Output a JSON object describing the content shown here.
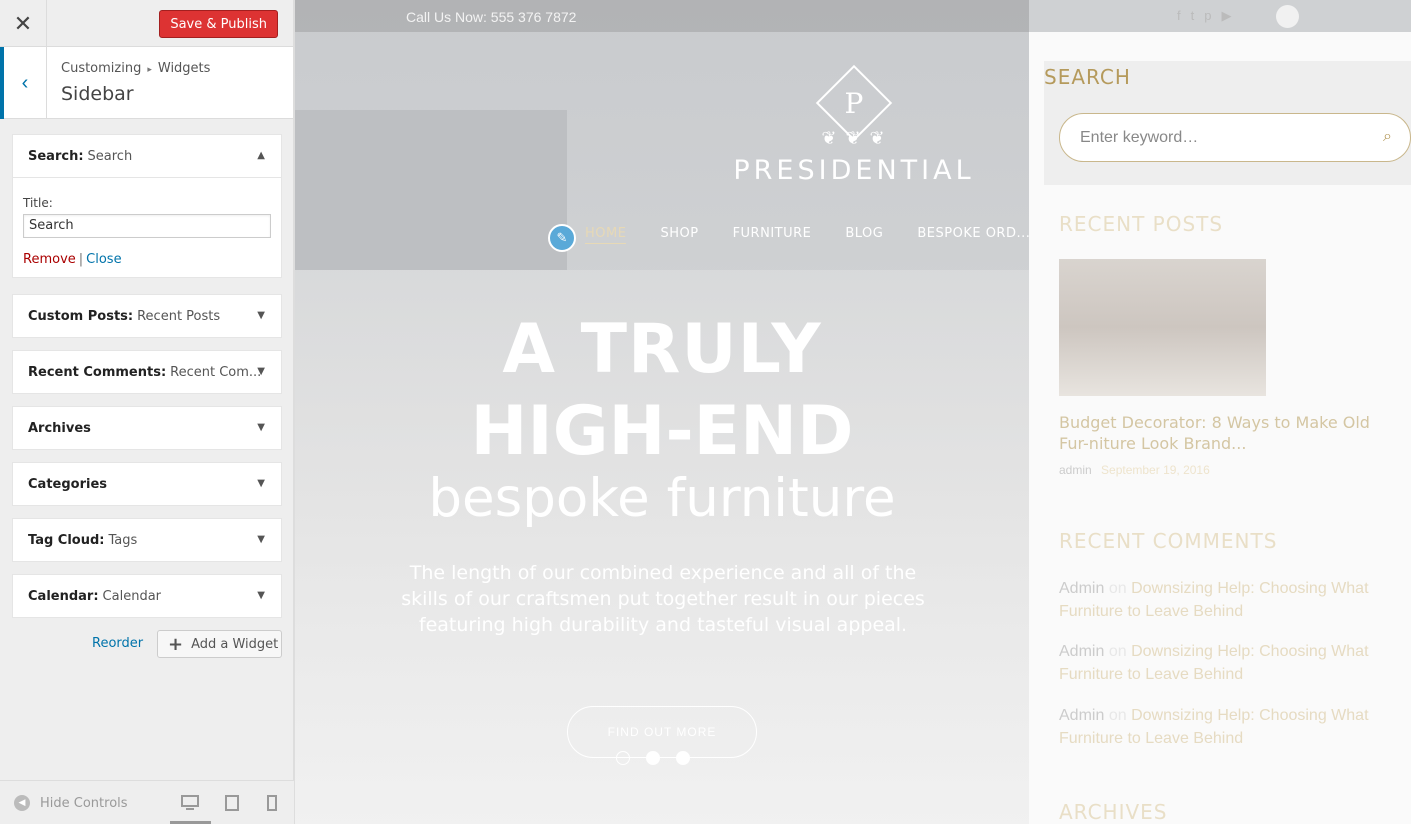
{
  "customizer": {
    "close_icon": "close-icon",
    "publish_label": "Save & Publish",
    "breadcrumb": {
      "root": "Customizing",
      "separator": "▸",
      "current": "Widgets"
    },
    "section_title": "Sidebar",
    "widgets": [
      {
        "name": "Search",
        "title": "Search",
        "expanded": true
      },
      {
        "name": "Custom Posts",
        "title": "Recent Posts",
        "expanded": false
      },
      {
        "name": "Recent Comments",
        "title": "Recent Com...",
        "expanded": false
      },
      {
        "name": "Archives",
        "title": "",
        "expanded": false
      },
      {
        "name": "Categories",
        "title": "",
        "expanded": false
      },
      {
        "name": "Tag Cloud",
        "title": "Tags",
        "expanded": false
      },
      {
        "name": "Calendar",
        "title": "Calendar",
        "expanded": false
      }
    ],
    "search_widget_form": {
      "title_label": "Title:",
      "title_value": "Search",
      "remove_label": "Remove",
      "close_label": "Close",
      "pipe": "|"
    },
    "reorder_label": "Reorder",
    "add_widget_label": "Add a Widget",
    "hide_controls_label": "Hide Controls",
    "colors": {
      "publish": "#dd3333",
      "accent": "#0073aa",
      "remove": "#aa0000"
    }
  },
  "preview": {
    "call_us": "Call Us Now: 555 376 7872",
    "social_icons": [
      "facebook-icon",
      "twitter-icon",
      "pinterest-icon",
      "youtube-icon"
    ],
    "social_glyphs": [
      "f",
      "t",
      "p",
      "▶"
    ],
    "logo_letter": "P",
    "logo_text": "PRESIDENTIAL",
    "nav": [
      "HOME",
      "SHOP",
      "FURNITURE",
      "BLOG",
      "BESPOKE ORD..."
    ],
    "headline1": "A TRULY",
    "headline2": "HIGH-END",
    "headline3": "bespoke furniture",
    "hero_text": "The length of our combined experience and all of the skills of our craftsmen put together result in our pieces featuring high durability and tasteful visual appeal.",
    "cta": "FIND OUT MORE",
    "slider_active_dot": 1,
    "sidebar": {
      "search_title": "SEARCH",
      "search_placeholder": "Enter keyword…",
      "recent_posts_title": "RECENT POSTS",
      "post_title": "Budget Decorator: 8 Ways to Make Old Fur-niture Look Brand...",
      "post_author": "admin",
      "post_date": "September 19, 2016",
      "recent_comments_title": "RECENT COMMENTS",
      "comments": [
        {
          "author": "Admin",
          "on": "on",
          "link": "Downsizing Help: Choosing What Furniture to Leave Behind"
        },
        {
          "author": "Admin",
          "on": "on",
          "link": "Downsizing Help: Choosing What Furniture to Leave Behind"
        },
        {
          "author": "Admin",
          "on": "on",
          "link": "Downsizing Help: Choosing What Furniture to Leave Behind"
        }
      ],
      "archives_title": "ARCHIVES",
      "accent_color": "#b59a5c"
    }
  }
}
